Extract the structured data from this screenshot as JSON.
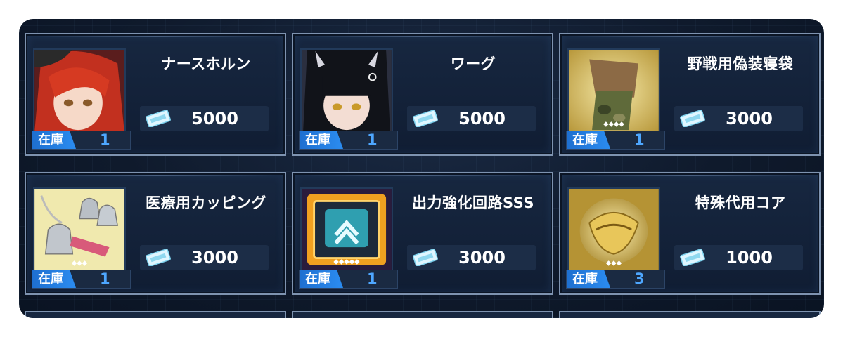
{
  "shop": {
    "stock_label": "在庫",
    "items": [
      {
        "name": "ナースホルン",
        "price": "5000",
        "stock": "1",
        "icon": "character-portrait-red-hair"
      },
      {
        "name": "ワーグ",
        "price": "5000",
        "stock": "1",
        "icon": "character-portrait-black-hair"
      },
      {
        "name": "野戦用偽装寝袋",
        "price": "3000",
        "stock": "1",
        "icon": "camouflage-sleeping-bag"
      },
      {
        "name": "医療用カッピング",
        "price": "3000",
        "stock": "1",
        "icon": "medical-cupping-set"
      },
      {
        "name": "出力強化回路SSS",
        "price": "3000",
        "stock": "1",
        "icon": "power-circuit-chip"
      },
      {
        "name": "特殊代用コア",
        "price": "1000",
        "stock": "3",
        "icon": "gold-core"
      }
    ],
    "colors": {
      "background": "#0f1a2c",
      "card_border": "#7e93b0",
      "stock_tag": "#2b8cf0",
      "stock_number": "#4ea7ff",
      "text": "#ffffff"
    }
  }
}
